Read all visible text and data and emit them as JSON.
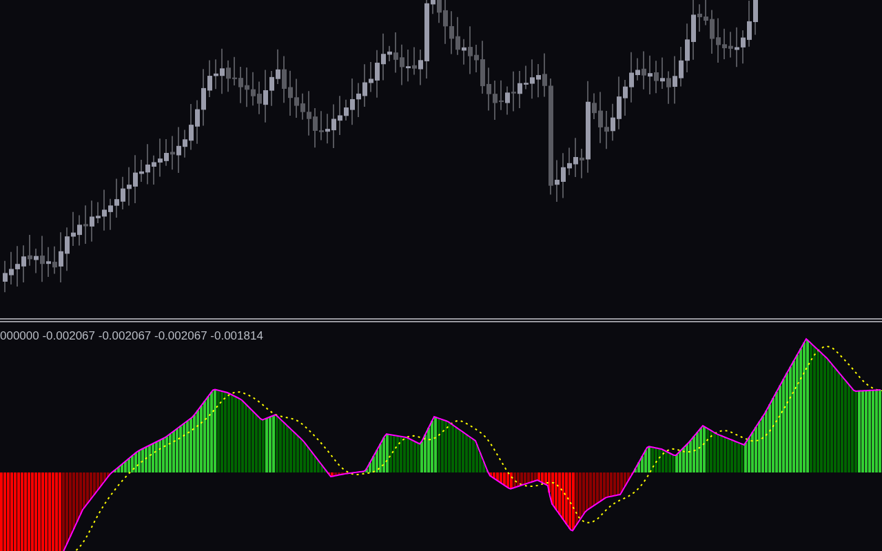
{
  "indicator_panel": {
    "values_label": "000000 -0.002067 -0.002067 -0.002067 -0.001814"
  }
}
